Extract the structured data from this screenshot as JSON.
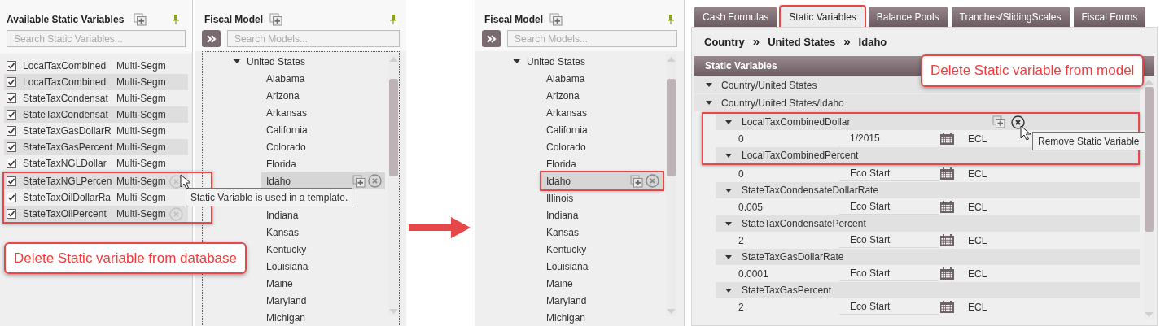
{
  "available_panel": {
    "title": "Available Static Variables",
    "search_placeholder": "Search Static Variables...",
    "rows": [
      {
        "name": "LocalTaxCombined",
        "type": "Multi-Segm",
        "checked": true,
        "remove_icon": false,
        "highlighted": false
      },
      {
        "name": "LocalTaxCombined",
        "type": "Multi-Segm",
        "checked": true,
        "remove_icon": false,
        "highlighted": false
      },
      {
        "name": "StateTaxCondensat",
        "type": "Multi-Segm",
        "checked": true,
        "remove_icon": false,
        "highlighted": false
      },
      {
        "name": "StateTaxCondensat",
        "type": "Multi-Segm",
        "checked": true,
        "remove_icon": false,
        "highlighted": false
      },
      {
        "name": "StateTaxGasDollarR",
        "type": "Multi-Segm",
        "checked": true,
        "remove_icon": false,
        "highlighted": false
      },
      {
        "name": "StateTaxGasPercent",
        "type": "Multi-Segm",
        "checked": true,
        "remove_icon": false,
        "highlighted": false
      },
      {
        "name": "StateTaxNGLDollar",
        "type": "Multi-Segm",
        "checked": true,
        "remove_icon": false,
        "highlighted": false
      },
      {
        "name": "StateTaxNGLPercen",
        "type": "Multi-Segm",
        "checked": true,
        "remove_icon": true,
        "highlighted": true
      },
      {
        "name": "StateTaxOilDollarRa",
        "type": "Multi-Segm",
        "checked": true,
        "remove_icon": false,
        "highlighted": true
      },
      {
        "name": "StateTaxOilPercent",
        "type": "Multi-Segm",
        "checked": true,
        "remove_icon": true,
        "highlighted": true
      }
    ],
    "tooltip": "Static Variable is used in a template.",
    "callout": "Delete Static variable from database"
  },
  "fiscal_panels": [
    {
      "title": "Fiscal Model",
      "search_placeholder": "Search Models...",
      "focused": true,
      "tree": [
        {
          "label": "United States",
          "expanded": true,
          "children": [
            {
              "label": "Alabama",
              "selected": false
            },
            {
              "label": "Arizona",
              "selected": false
            },
            {
              "label": "Arkansas",
              "selected": false
            },
            {
              "label": "California",
              "selected": false
            },
            {
              "label": "Colorado",
              "selected": false
            },
            {
              "label": "Florida",
              "selected": false
            },
            {
              "label": "Idaho",
              "selected": true,
              "highlighted": false
            },
            {
              "label": "Indiana",
              "selected": false
            },
            {
              "label": "Kansas",
              "selected": false
            },
            {
              "label": "Kentucky",
              "selected": false
            },
            {
              "label": "Louisiana",
              "selected": false
            },
            {
              "label": "Maine",
              "selected": false
            },
            {
              "label": "Maryland",
              "selected": false
            },
            {
              "label": "Michigan",
              "selected": false
            }
          ]
        }
      ]
    },
    {
      "title": "Fiscal Model",
      "search_placeholder": "Search Models...",
      "focused": false,
      "tree": [
        {
          "label": "United States",
          "expanded": true,
          "children": [
            {
              "label": "Alabama",
              "selected": false
            },
            {
              "label": "Arizona",
              "selected": false
            },
            {
              "label": "Arkansas",
              "selected": false
            },
            {
              "label": "California",
              "selected": false
            },
            {
              "label": "Colorado",
              "selected": false
            },
            {
              "label": "Florida",
              "selected": false
            },
            {
              "label": "Idaho",
              "selected": true,
              "highlighted": true
            },
            {
              "label": "Illinois",
              "selected": false
            },
            {
              "label": "Indiana",
              "selected": false
            },
            {
              "label": "Kansas",
              "selected": false
            },
            {
              "label": "Kentucky",
              "selected": false
            },
            {
              "label": "Louisiana",
              "selected": false
            },
            {
              "label": "Maine",
              "selected": false
            },
            {
              "label": "Maryland",
              "selected": false
            },
            {
              "label": "Michigan",
              "selected": false
            }
          ]
        }
      ]
    }
  ],
  "model_panel": {
    "tabs": [
      {
        "label": "Cash Formulas",
        "selected": false,
        "highlighted": false
      },
      {
        "label": "Static Variables",
        "selected": true,
        "highlighted": true
      },
      {
        "label": "Balance Pools",
        "selected": false,
        "highlighted": false
      },
      {
        "label": "Tranches/SlidingScales",
        "selected": false,
        "highlighted": false
      },
      {
        "label": "Fiscal Forms",
        "selected": false,
        "highlighted": false
      }
    ],
    "breadcrumb": [
      "Country",
      "United States",
      "Idaho"
    ],
    "breadcrumb_separator": "»",
    "section_title": "Static Variables",
    "callout": "Delete Static variable from model",
    "groups": [
      {
        "label": "Country/United States",
        "expanded": true
      },
      {
        "label": "Country/United States/Idaho",
        "expanded": true,
        "variables": [
          {
            "name": "LocalTaxCombinedDollar",
            "expanded": true,
            "value": "0",
            "date": "1/2015",
            "unit": "ECL",
            "hovered": true,
            "header_highlighted": true,
            "values_highlighted": true
          },
          {
            "name": "LocalTaxCombinedPercent",
            "expanded": true,
            "value": "0",
            "date": "Eco Start",
            "unit": "ECL",
            "hovered": false,
            "header_highlighted": true,
            "values_highlighted": false
          },
          {
            "name": "StateTaxCondensateDollarRate",
            "expanded": true,
            "value": "0.005",
            "date": "Eco Start",
            "unit": "ECL",
            "hovered": false
          },
          {
            "name": "StateTaxCondensatePercent",
            "expanded": true,
            "value": "2",
            "date": "Eco Start",
            "unit": "ECL",
            "hovered": false
          },
          {
            "name": "StateTaxGasDollarRate",
            "expanded": true,
            "value": "0.0001",
            "date": "Eco Start",
            "unit": "ECL",
            "hovered": false
          },
          {
            "name": "StateTaxGasPercent",
            "expanded": true,
            "value": "2",
            "date": "Eco Start",
            "unit": "ECL",
            "hovered": false
          }
        ]
      }
    ],
    "tooltip": "Remove Static Variable"
  }
}
